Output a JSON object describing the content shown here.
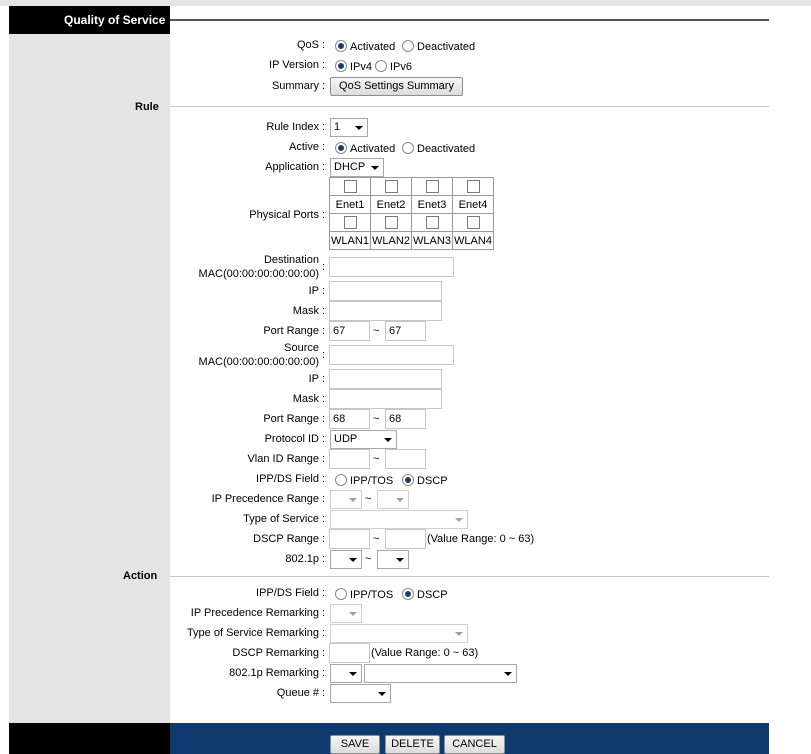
{
  "sidebar": {
    "title": "Quality of Service"
  },
  "sections": {
    "rule": "Rule",
    "action": "Action"
  },
  "qos": {
    "label": "QoS",
    "activated": "Activated",
    "deactivated": "Deactivated"
  },
  "ipversion": {
    "label": "IP Version",
    "ipv4": "IPv4",
    "ipv6": "IPv6"
  },
  "summary": {
    "label": "Summary",
    "button": "QoS Settings Summary"
  },
  "rule": {
    "index": {
      "label": "Rule Index",
      "value": "1"
    },
    "active": {
      "label": "Active",
      "activated": "Activated",
      "deactivated": "Deactivated"
    },
    "application": {
      "label": "Application",
      "value": "DHCP"
    },
    "physical_ports": {
      "label": "Physical Ports",
      "row1": [
        "Enet1",
        "Enet2",
        "Enet3",
        "Enet4"
      ],
      "row2": [
        "WLAN1",
        "WLAN2",
        "WLAN3",
        "WLAN4"
      ]
    },
    "destination": {
      "label": "Destination",
      "mac_label": "MAC(00:00:00:00:00:00)",
      "ip_label": "IP",
      "mask_label": "Mask",
      "port_range_label": "Port Range",
      "port_from": "67",
      "port_to": "67"
    },
    "source": {
      "label": "Source",
      "mac_label": "MAC(00:00:00:00:00:00)",
      "ip_label": "IP",
      "mask_label": "Mask",
      "port_range_label": "Port Range",
      "port_from": "68",
      "port_to": "68"
    },
    "protocol": {
      "label": "Protocol ID",
      "value": "UDP"
    },
    "vlan": {
      "label": "Vlan ID Range"
    },
    "ippds": {
      "label": "IPP/DS Field",
      "opt1": "IPP/TOS",
      "opt2": "DSCP"
    },
    "ip_precedence": {
      "label": "IP Precedence Range"
    },
    "tos": {
      "label": "Type of Service"
    },
    "dscp": {
      "label": "DSCP Range",
      "hint": "(Value Range: 0 ~ 63)"
    },
    "p8021": {
      "label": "802.1p"
    }
  },
  "action": {
    "ippds": {
      "label": "IPP/DS Field",
      "opt1": "IPP/TOS",
      "opt2": "DSCP"
    },
    "ip_prec_remark": {
      "label": "IP Precedence Remarking"
    },
    "tos_remark": {
      "label": "Type of Service Remarking"
    },
    "dscp_remark": {
      "label": "DSCP Remarking",
      "hint": "(Value Range: 0 ~ 63)"
    },
    "p8021_remark": {
      "label": "802.1p Remarking"
    },
    "queue": {
      "label": "Queue #"
    }
  },
  "footer": {
    "save": "SAVE",
    "delete": "DELETE",
    "cancel": "CANCEL"
  },
  "tilde": "~",
  "colon": ":"
}
